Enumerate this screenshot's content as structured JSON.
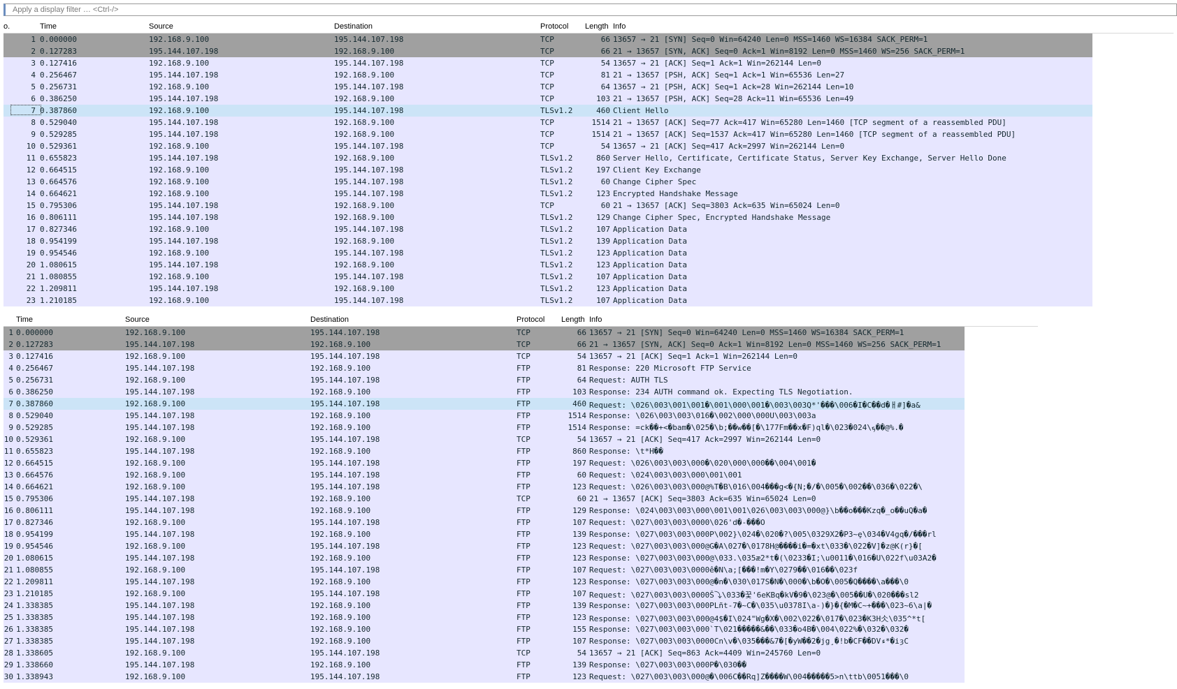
{
  "filter": {
    "placeholder": "Apply a display filter … <Ctrl-/>"
  },
  "colors": {
    "syn": "#a0a0a0",
    "tcp": "#e7e6ff",
    "selected": "#cce4f7",
    "filter_accent": "#6c8ebf"
  },
  "top": {
    "headers": {
      "no": "o.",
      "time": "Time",
      "source": "Source",
      "destination": "Destination",
      "protocol": "Protocol",
      "length": "Length",
      "info": "Info"
    },
    "rows": [
      {
        "no": "1",
        "time": "0.000000",
        "src": "192.168.9.100",
        "dst": "195.144.107.198",
        "proto": "TCP",
        "len": "66",
        "info": "13657 → 21 [SYN] Seq=0 Win=64240 Len=0 MSS=1460 WS=16384 SACK_PERM=1",
        "style": "syn"
      },
      {
        "no": "2",
        "time": "0.127283",
        "src": "195.144.107.198",
        "dst": "192.168.9.100",
        "proto": "TCP",
        "len": "66",
        "info": "21 → 13657 [SYN, ACK] Seq=0 Ack=1 Win=8192 Len=0 MSS=1460 WS=256 SACK_PERM=1",
        "style": "syn"
      },
      {
        "no": "3",
        "time": "0.127416",
        "src": "192.168.9.100",
        "dst": "195.144.107.198",
        "proto": "TCP",
        "len": "54",
        "info": "13657 → 21 [ACK] Seq=1 Ack=1 Win=262144 Len=0",
        "style": "tcp"
      },
      {
        "no": "4",
        "time": "0.256467",
        "src": "195.144.107.198",
        "dst": "192.168.9.100",
        "proto": "TCP",
        "len": "81",
        "info": "21 → 13657 [PSH, ACK] Seq=1 Ack=1 Win=65536 Len=27",
        "style": "tcp"
      },
      {
        "no": "5",
        "time": "0.256731",
        "src": "192.168.9.100",
        "dst": "195.144.107.198",
        "proto": "TCP",
        "len": "64",
        "info": "13657 → 21 [PSH, ACK] Seq=1 Ack=28 Win=262144 Len=10",
        "style": "tcp"
      },
      {
        "no": "6",
        "time": "0.386250",
        "src": "195.144.107.198",
        "dst": "192.168.9.100",
        "proto": "TCP",
        "len": "103",
        "info": "21 → 13657 [PSH, ACK] Seq=28 Ack=11 Win=65536 Len=49",
        "style": "tcp"
      },
      {
        "no": "7",
        "time": "0.387860",
        "src": "192.168.9.100",
        "dst": "195.144.107.198",
        "proto": "TLSv1.2",
        "len": "460",
        "info": "Client Hello",
        "style": "selected"
      },
      {
        "no": "8",
        "time": "0.529040",
        "src": "195.144.107.198",
        "dst": "192.168.9.100",
        "proto": "TCP",
        "len": "1514",
        "info": "21 → 13657 [ACK] Seq=77 Ack=417 Win=65280 Len=1460 [TCP segment of a reassembled PDU]",
        "style": "tcp"
      },
      {
        "no": "9",
        "time": "0.529285",
        "src": "195.144.107.198",
        "dst": "192.168.9.100",
        "proto": "TCP",
        "len": "1514",
        "info": "21 → 13657 [ACK] Seq=1537 Ack=417 Win=65280 Len=1460 [TCP segment of a reassembled PDU]",
        "style": "tcp"
      },
      {
        "no": "10",
        "time": "0.529361",
        "src": "192.168.9.100",
        "dst": "195.144.107.198",
        "proto": "TCP",
        "len": "54",
        "info": "13657 → 21 [ACK] Seq=417 Ack=2997 Win=262144 Len=0",
        "style": "tcp"
      },
      {
        "no": "11",
        "time": "0.655823",
        "src": "195.144.107.198",
        "dst": "192.168.9.100",
        "proto": "TLSv1.2",
        "len": "860",
        "info": "Server Hello, Certificate, Certificate Status, Server Key Exchange, Server Hello Done",
        "style": "tcp"
      },
      {
        "no": "12",
        "time": "0.664515",
        "src": "192.168.9.100",
        "dst": "195.144.107.198",
        "proto": "TLSv1.2",
        "len": "197",
        "info": "Client Key Exchange",
        "style": "tcp"
      },
      {
        "no": "13",
        "time": "0.664576",
        "src": "192.168.9.100",
        "dst": "195.144.107.198",
        "proto": "TLSv1.2",
        "len": "60",
        "info": "Change Cipher Spec",
        "style": "tcp"
      },
      {
        "no": "14",
        "time": "0.664621",
        "src": "192.168.9.100",
        "dst": "195.144.107.198",
        "proto": "TLSv1.2",
        "len": "123",
        "info": "Encrypted Handshake Message",
        "style": "tcp"
      },
      {
        "no": "15",
        "time": "0.795306",
        "src": "195.144.107.198",
        "dst": "192.168.9.100",
        "proto": "TCP",
        "len": "60",
        "info": "21 → 13657 [ACK] Seq=3803 Ack=635 Win=65024 Len=0",
        "style": "tcp"
      },
      {
        "no": "16",
        "time": "0.806111",
        "src": "195.144.107.198",
        "dst": "192.168.9.100",
        "proto": "TLSv1.2",
        "len": "129",
        "info": "Change Cipher Spec, Encrypted Handshake Message",
        "style": "tcp"
      },
      {
        "no": "17",
        "time": "0.827346",
        "src": "192.168.9.100",
        "dst": "195.144.107.198",
        "proto": "TLSv1.2",
        "len": "107",
        "info": "Application Data",
        "style": "tcp"
      },
      {
        "no": "18",
        "time": "0.954199",
        "src": "195.144.107.198",
        "dst": "192.168.9.100",
        "proto": "TLSv1.2",
        "len": "139",
        "info": "Application Data",
        "style": "tcp"
      },
      {
        "no": "19",
        "time": "0.954546",
        "src": "192.168.9.100",
        "dst": "195.144.107.198",
        "proto": "TLSv1.2",
        "len": "123",
        "info": "Application Data",
        "style": "tcp"
      },
      {
        "no": "20",
        "time": "1.080615",
        "src": "195.144.107.198",
        "dst": "192.168.9.100",
        "proto": "TLSv1.2",
        "len": "123",
        "info": "Application Data",
        "style": "tcp"
      },
      {
        "no": "21",
        "time": "1.080855",
        "src": "192.168.9.100",
        "dst": "195.144.107.198",
        "proto": "TLSv1.2",
        "len": "107",
        "info": "Application Data",
        "style": "tcp"
      },
      {
        "no": "22",
        "time": "1.209811",
        "src": "195.144.107.198",
        "dst": "192.168.9.100",
        "proto": "TLSv1.2",
        "len": "123",
        "info": "Application Data",
        "style": "tcp"
      },
      {
        "no": "23",
        "time": "1.210185",
        "src": "192.168.9.100",
        "dst": "195.144.107.198",
        "proto": "TLSv1.2",
        "len": "107",
        "info": "Application Data",
        "style": "tcp"
      }
    ]
  },
  "bottom": {
    "headers": {
      "time": "Time",
      "source": "Source",
      "destination": "Destination",
      "protocol": "Protocol",
      "length": "Length",
      "info": "Info"
    },
    "rows": [
      {
        "no": "1",
        "time": "0.000000",
        "src": "192.168.9.100",
        "dst": "195.144.107.198",
        "proto": "TCP",
        "len": "66",
        "info": "13657 → 21 [SYN] Seq=0 Win=64240 Len=0 MSS=1460 WS=16384 SACK_PERM=1",
        "style": "syn"
      },
      {
        "no": "2",
        "time": "0.127283",
        "src": "195.144.107.198",
        "dst": "192.168.9.100",
        "proto": "TCP",
        "len": "66",
        "info": "21 → 13657 [SYN, ACK] Seq=0 Ack=1 Win=8192 Len=0 MSS=1460 WS=256 SACK_PERM=1",
        "style": "syn"
      },
      {
        "no": "3",
        "time": "0.127416",
        "src": "192.168.9.100",
        "dst": "195.144.107.198",
        "proto": "TCP",
        "len": "54",
        "info": "13657 → 21 [ACK] Seq=1 Ack=1 Win=262144 Len=0",
        "style": "tcp"
      },
      {
        "no": "4",
        "time": "0.256467",
        "src": "195.144.107.198",
        "dst": "192.168.9.100",
        "proto": "FTP",
        "len": "81",
        "info": "Response: 220 Microsoft FTP Service",
        "style": "tcp"
      },
      {
        "no": "5",
        "time": "0.256731",
        "src": "192.168.9.100",
        "dst": "195.144.107.198",
        "proto": "FTP",
        "len": "64",
        "info": "Request: AUTH TLS",
        "style": "tcp"
      },
      {
        "no": "6",
        "time": "0.386250",
        "src": "195.144.107.198",
        "dst": "192.168.9.100",
        "proto": "FTP",
        "len": "103",
        "info": "Response: 234 AUTH command ok. Expecting TLS Negotiation.",
        "style": "tcp"
      },
      {
        "no": "7",
        "time": "0.387860",
        "src": "192.168.9.100",
        "dst": "195.144.107.198",
        "proto": "FTP",
        "len": "460",
        "info": "Request: \\026\\003\\001\\001�\\001\\000\\001�\\003\\003Q*'���\\006�I�C��d�ㅐ#]�a&",
        "style": "selected"
      },
      {
        "no": "8",
        "time": "0.529040",
        "src": "195.144.107.198",
        "dst": "192.168.9.100",
        "proto": "FTP",
        "len": "1514",
        "info": "Response: \\026\\003\\003\\016�\\002\\000\\000U\\003\\003a",
        "style": "tcp"
      },
      {
        "no": "9",
        "time": "0.529285",
        "src": "195.144.107.198",
        "dst": "192.168.9.100",
        "proto": "FTP",
        "len": "1514",
        "info": "Response: =ck��+<�bam�\\025�\\b;��w��[�\\177Fm��x�F)ql�\\023�024\\ܟ��@%.�",
        "style": "tcp"
      },
      {
        "no": "10",
        "time": "0.529361",
        "src": "192.168.9.100",
        "dst": "195.144.107.198",
        "proto": "TCP",
        "len": "54",
        "info": "13657 → 21 [ACK] Seq=417 Ack=2997 Win=262144 Len=0",
        "style": "tcp"
      },
      {
        "no": "11",
        "time": "0.655823",
        "src": "195.144.107.198",
        "dst": "192.168.9.100",
        "proto": "FTP",
        "len": "860",
        "info": "Response: \\t*H��",
        "style": "tcp"
      },
      {
        "no": "12",
        "time": "0.664515",
        "src": "192.168.9.100",
        "dst": "195.144.107.198",
        "proto": "FTP",
        "len": "197",
        "info": "Request: \\026\\003\\003\\000�\\020\\000\\000��\\004\\001�",
        "style": "tcp"
      },
      {
        "no": "13",
        "time": "0.664576",
        "src": "192.168.9.100",
        "dst": "195.144.107.198",
        "proto": "FTP",
        "len": "60",
        "info": "Request: \\024\\003\\003\\000\\001\\001",
        "style": "tcp"
      },
      {
        "no": "14",
        "time": "0.664621",
        "src": "192.168.9.100",
        "dst": "195.144.107.198",
        "proto": "FTP",
        "len": "123",
        "info": "Request: \\026\\003\\003\\000@%T�B\\016\\004���g<�{N;�/�\\005�\\002��\\036�\\022�\\",
        "style": "tcp"
      },
      {
        "no": "15",
        "time": "0.795306",
        "src": "195.144.107.198",
        "dst": "192.168.9.100",
        "proto": "TCP",
        "len": "60",
        "info": "21 → 13657 [ACK] Seq=3803 Ack=635 Win=65024 Len=0",
        "style": "tcp"
      },
      {
        "no": "16",
        "time": "0.806111",
        "src": "195.144.107.198",
        "dst": "192.168.9.100",
        "proto": "FTP",
        "len": "129",
        "info": "Response: \\024\\003\\003\\000\\001\\001\\026\\003\\003\\000@}\\b��o���Kzq�_o��uQ�a�",
        "style": "tcp"
      },
      {
        "no": "17",
        "time": "0.827346",
        "src": "192.168.9.100",
        "dst": "195.144.107.198",
        "proto": "FTP",
        "len": "107",
        "info": "Request: \\027\\003\\003\\0000\\026'd�-���O",
        "style": "tcp"
      },
      {
        "no": "18",
        "time": "0.954199",
        "src": "195.144.107.198",
        "dst": "192.168.9.100",
        "proto": "FTP",
        "len": "139",
        "info": "Response: \\027\\003\\003\\000P\\002}\\024�\\020�?\\005\\0329X2�P3~ȩ\\034�V4gq�/���rl",
        "style": "tcp"
      },
      {
        "no": "19",
        "time": "0.954546",
        "src": "192.168.9.100",
        "dst": "195.144.107.198",
        "proto": "FTP",
        "len": "123",
        "info": "Request: \\027\\003\\003\\000@G�A\\027�\\0178H@����i�=�xt\\033�\\022�V]�z@K(r}�[",
        "style": "tcp"
      },
      {
        "no": "20",
        "time": "1.080615",
        "src": "195.144.107.198",
        "dst": "192.168.9.100",
        "proto": "FTP",
        "len": "123",
        "info": "Response: \\027\\003\\003\\000@\\033.\\035æ2*t�(\\0233�I;\\u0011�\\016�U\\022f\\u03A2�",
        "style": "tcp"
      },
      {
        "no": "21",
        "time": "1.080855",
        "src": "192.168.9.100",
        "dst": "195.144.107.198",
        "proto": "FTP",
        "len": "107",
        "info": "Request: \\027\\003\\003\\0000ê�N\\a;[���!m�Y\\0279��\\016��\\023f",
        "style": "tcp"
      },
      {
        "no": "22",
        "time": "1.209811",
        "src": "195.144.107.198",
        "dst": "192.168.9.100",
        "proto": "FTP",
        "len": "123",
        "info": "Response: \\027\\003\\003\\000@�n�\\030\\017S�N�\\000�\\b�O�\\005�Q����\\a���\\0",
        "style": "tcp"
      },
      {
        "no": "23",
        "time": "1.210185",
        "src": "192.168.9.100",
        "dst": "195.144.107.198",
        "proto": "FTP",
        "len": "107",
        "info": "Request: \\027\\003\\003\\0000Š⤵\\033�꿏'6eKBq�kV�9�\\023@�\\005��U�\\020���sl2",
        "style": "tcp"
      },
      {
        "no": "24",
        "time": "1.338385",
        "src": "195.144.107.198",
        "dst": "192.168.9.100",
        "proto": "FTP",
        "len": "139",
        "info": "Response: \\027\\003\\003\\000PLñt-7�~C�\\035\\u0378I\\a-)�}�{�M�C~+���\\023~6\\a|�",
        "style": "tcp"
      },
      {
        "no": "25",
        "time": "1.338385",
        "src": "195.144.107.198",
        "dst": "192.168.9.100",
        "proto": "FTP",
        "len": "123",
        "info": "Response: \\027\\003\\003\\000@4$�I\\024\"Wg�X�\\002\\022�\\017�\\023�K3H仌\\035^*t[",
        "style": "tcp"
      },
      {
        "no": "26",
        "time": "1.338385",
        "src": "195.144.107.198",
        "dst": "192.168.9.100",
        "proto": "FTP",
        "len": "155",
        "info": "Response: \\027\\003\\003\\000`T\\021�����&��\\033�o4B�\\004\\022%�\\032�\\032�",
        "style": "tcp"
      },
      {
        "no": "27",
        "time": "1.338385",
        "src": "195.144.107.198",
        "dst": "192.168.9.100",
        "proto": "FTP",
        "len": "107",
        "info": "Response: \\027\\003\\003\\0000Cn\\v�\\035���&7�[�yW��2�jg¸�!b�CF��DVء*�iȝC",
        "style": "tcp"
      },
      {
        "no": "28",
        "time": "1.338605",
        "src": "192.168.9.100",
        "dst": "195.144.107.198",
        "proto": "TCP",
        "len": "54",
        "info": "13657 → 21 [ACK] Seq=863 Ack=4409 Win=245760 Len=0",
        "style": "tcp"
      },
      {
        "no": "29",
        "time": "1.338660",
        "src": "195.144.107.198",
        "dst": "192.168.9.100",
        "proto": "FTP",
        "len": "139",
        "info": "Response: \\027\\003\\003\\000P�\\030��",
        "style": "tcp"
      },
      {
        "no": "30",
        "time": "1.338943",
        "src": "192.168.9.100",
        "dst": "195.144.107.198",
        "proto": "FTP",
        "len": "123",
        "info": "Request: \\027\\003\\003\\000@�\\006C��Rq]Z����W\\004�����5>n\\ttb\\0051���\\0",
        "style": "tcp"
      }
    ]
  }
}
